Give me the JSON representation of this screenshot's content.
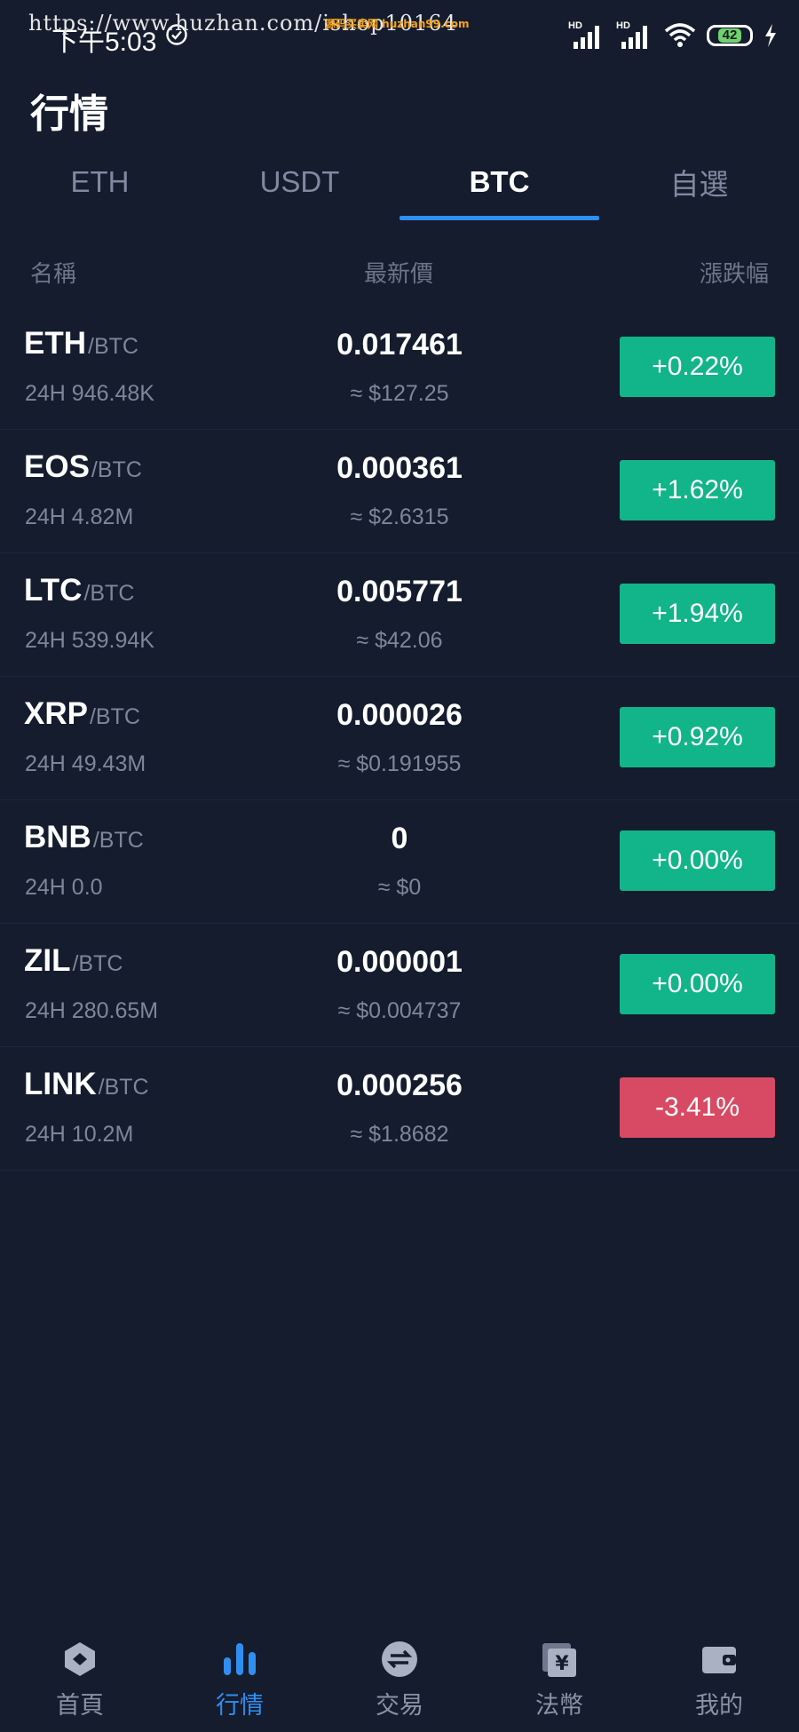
{
  "status_bar": {
    "time": "下午5:03",
    "watermark_url": "https://www.huzhan.com/ishop10164",
    "watermark_logo": "源码买卖网 huzhan99.com",
    "signal_1": "HD",
    "signal_2": "HD",
    "battery": "42"
  },
  "header": {
    "title": "行情"
  },
  "tabs": [
    {
      "label": "ETH",
      "active": false
    },
    {
      "label": "USDT",
      "active": false
    },
    {
      "label": "BTC",
      "active": true
    },
    {
      "label": "自選",
      "active": false
    }
  ],
  "columns": {
    "name": "名稱",
    "price": "最新價",
    "change": "漲跌幅"
  },
  "rows": [
    {
      "base": "ETH",
      "quote": "/BTC",
      "volume": "24H 946.48K",
      "price": "0.017461",
      "usd": "≈ $127.25",
      "change": "+0.22%",
      "direction": "up"
    },
    {
      "base": "EOS",
      "quote": "/BTC",
      "volume": "24H 4.82M",
      "price": "0.000361",
      "usd": "≈ $2.6315",
      "change": "+1.62%",
      "direction": "up"
    },
    {
      "base": "LTC",
      "quote": "/BTC",
      "volume": "24H 539.94K",
      "price": "0.005771",
      "usd": "≈ $42.06",
      "change": "+1.94%",
      "direction": "up"
    },
    {
      "base": "XRP",
      "quote": "/BTC",
      "volume": "24H 49.43M",
      "price": "0.000026",
      "usd": "≈ $0.191955",
      "change": "+0.92%",
      "direction": "up"
    },
    {
      "base": "BNB",
      "quote": "/BTC",
      "volume": "24H 0.0",
      "price": "0",
      "usd": "≈ $0",
      "change": "+0.00%",
      "direction": "up"
    },
    {
      "base": "ZIL",
      "quote": "/BTC",
      "volume": "24H 280.65M",
      "price": "0.000001",
      "usd": "≈ $0.004737",
      "change": "+0.00%",
      "direction": "up"
    },
    {
      "base": "LINK",
      "quote": "/BTC",
      "volume": "24H 10.2M",
      "price": "0.000256",
      "usd": "≈ $1.8682",
      "change": "-3.41%",
      "direction": "down"
    }
  ],
  "bottom_nav": [
    {
      "label": "首頁",
      "icon": "home-icon",
      "active": false
    },
    {
      "label": "行情",
      "icon": "market-chart-icon",
      "active": true
    },
    {
      "label": "交易",
      "icon": "exchange-icon",
      "active": false
    },
    {
      "label": "法幣",
      "icon": "fiat-currency-icon",
      "active": false
    },
    {
      "label": "我的",
      "icon": "wallet-icon",
      "active": false
    }
  ],
  "colors": {
    "background": "#151c2e",
    "accent": "#2f8ff0",
    "up": "#12b48a",
    "down": "#d84a63",
    "muted_text": "#7e869b"
  }
}
